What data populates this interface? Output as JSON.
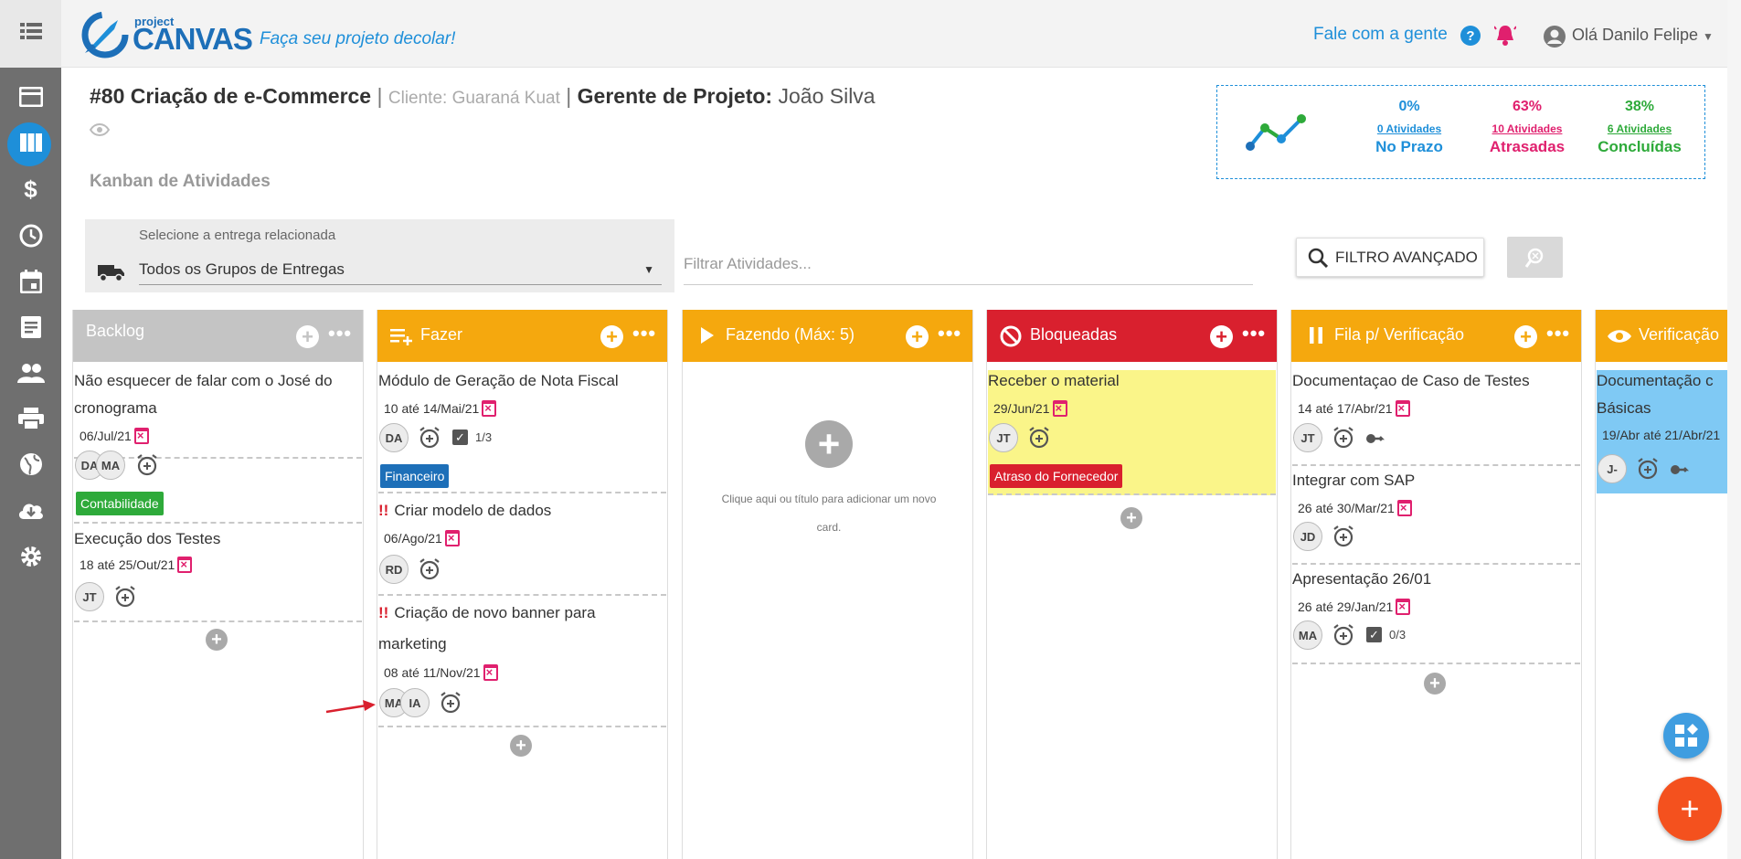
{
  "header": {
    "logo_small": "project",
    "logo_big": "CANVAS",
    "tagline": "Faça seu projeto decolar!",
    "contact": "Fale com a gente",
    "user": "Olá Danilo Felipe"
  },
  "project": {
    "title": "#80 Criação de e-Commerce",
    "client": "Cliente: Guaraná Kuat",
    "manager_label": "Gerente de Projeto:",
    "manager": "João Silva",
    "subtitle": "Kanban de Atividades"
  },
  "stats": [
    {
      "pct": "0%",
      "count": "0 Atividades",
      "label": "No Prazo",
      "color": "#1e8fd9"
    },
    {
      "pct": "63%",
      "count": "10 Atividades",
      "label": "Atrasadas",
      "color": "#e0206e"
    },
    {
      "pct": "38%",
      "count": "6 Atividades",
      "label": "Concluídas",
      "color": "#2eaa3a"
    }
  ],
  "filters": {
    "entrega_label": "Selecione a entrega relacionada",
    "entrega_value": "Todos os Grupos de Entregas",
    "search_placeholder": "Filtrar Atividades...",
    "advanced": "FILTRO AVANÇADO"
  },
  "columns": [
    {
      "title": "Backlog",
      "color": "#c4c4c4"
    },
    {
      "title": "Fazer",
      "color": "#f5a80e"
    },
    {
      "title": "Fazendo (Máx: 5)",
      "color": "#f5a80e"
    },
    {
      "title": "Bloqueadas",
      "color": "#d9202e"
    },
    {
      "title": "Fila p/ Verificação",
      "color": "#f5a80e"
    },
    {
      "title": "Verificação",
      "color": "#f5a80e"
    }
  ],
  "cards": {
    "backlog": [
      {
        "title1": "Não esquecer de falar com o José do",
        "title2": "cronograma",
        "date": "06/Jul/21",
        "avatars": [
          "DA",
          "MA"
        ],
        "tag": "Contabilidade"
      },
      {
        "title1": "Execução dos Testes",
        "date": "18 até 25/Out/21",
        "avatars": [
          "JT"
        ]
      }
    ],
    "fazer": [
      {
        "title1": "Módulo de Geração de Nota Fiscal",
        "date": "10 até 14/Mai/21",
        "avatars": [
          "DA"
        ],
        "checklist": "1/3",
        "tag": "Financeiro"
      },
      {
        "title1": "Criar modelo de dados",
        "date": "06/Ago/21",
        "avatars": [
          "RD"
        ]
      },
      {
        "title1": "Criação de novo banner para",
        "title2": "marketing",
        "date": "08 até 11/Nov/21",
        "avatars": [
          "MA",
          "IA"
        ]
      }
    ],
    "fazendo_empty": "Clique aqui ou título para adicionar um novo card.",
    "bloqueadas": [
      {
        "title1": "Receber o material",
        "date": "29/Jun/21",
        "avatars": [
          "JT"
        ],
        "tag": "Atraso do Fornecedor"
      }
    ],
    "fila": [
      {
        "title1": "Documentaçao de Caso de Testes",
        "date": "14 até 17/Abr/21",
        "avatars": [
          "JT"
        ]
      },
      {
        "title1": "Integrar com SAP",
        "date": "26 até 30/Mar/21",
        "avatars": [
          "JD"
        ]
      },
      {
        "title1": "Apresentação 26/01",
        "date": "26 até 29/Jan/21",
        "avatars": [
          "MA"
        ],
        "checklist": "0/3"
      }
    ],
    "verificacao": [
      {
        "title1": "Documentação c",
        "title2": "Básicas",
        "date": "19/Abr até 21/Abr/21",
        "avatars": [
          "J-"
        ]
      }
    ]
  }
}
